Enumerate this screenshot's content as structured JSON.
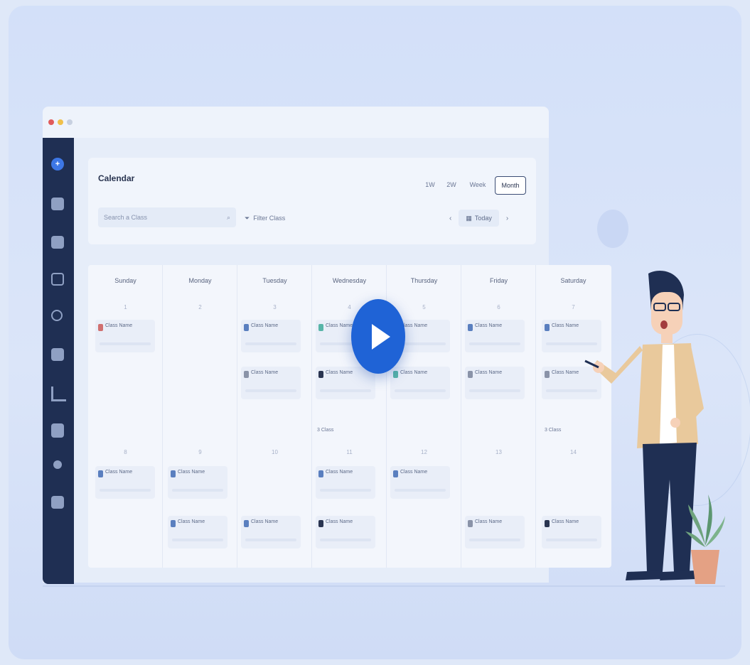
{
  "calendar": {
    "title": "Calendar",
    "views": [
      "1W",
      "2W",
      "Week",
      "Month"
    ],
    "selected_view": "Month",
    "search_placeholder": "Search a Class",
    "filter_label": "Filter Class",
    "prev_symbol": "‹",
    "next_symbol": "›",
    "today_label": "Today",
    "days": [
      "Sunday",
      "Monday",
      "Tuesday",
      "Wednesday",
      "Thursday",
      "Friday",
      "Saturday"
    ],
    "row_dates": [
      [
        "1",
        "2",
        "3",
        "4",
        "5",
        "6",
        "7"
      ],
      [
        "8",
        "9",
        "10",
        "11",
        "12",
        "13",
        "14"
      ]
    ],
    "more_label": "3 Class",
    "event_label": "Class Name"
  },
  "sidebar": {
    "icons": [
      "add-icon",
      "file-icon",
      "calendar-icon",
      "edit-icon",
      "settings-icon",
      "chat-icon",
      "chart-icon",
      "document-icon",
      "star-icon",
      "folder-icon"
    ]
  },
  "colors": {
    "sidebar": "#1f2f53",
    "accent": "#3d77e6",
    "play_button": "#1f63d6",
    "event_blue": "#5a7fbf",
    "event_red": "#d07070",
    "event_teal": "#58b5a8",
    "event_dark": "#2a3551"
  }
}
